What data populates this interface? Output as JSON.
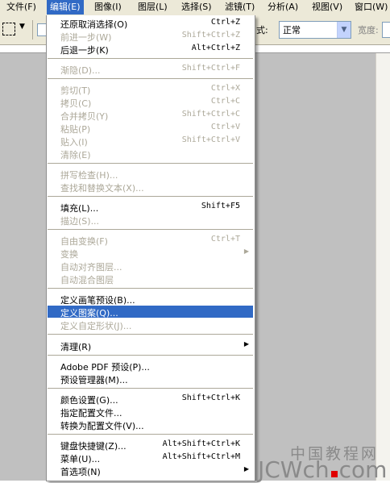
{
  "menubar": {
    "items": [
      {
        "label": "文件(F)"
      },
      {
        "label": "编辑(E)",
        "active": true
      },
      {
        "label": "图像(I)"
      },
      {
        "label": "图层(L)"
      },
      {
        "label": "选择(S)"
      },
      {
        "label": "滤镜(T)"
      },
      {
        "label": "分析(A)"
      },
      {
        "label": "视图(V)"
      },
      {
        "label": "窗口(W)"
      }
    ]
  },
  "options": {
    "mode_label": "式:",
    "mode_value": "正常",
    "width_label": "宽度:"
  },
  "edit_menu": {
    "items": [
      {
        "label": "还原取消选择(O)",
        "shortcut": "Ctrl+Z",
        "enabled": true
      },
      {
        "label": "前进一步(W)",
        "shortcut": "Shift+Ctrl+Z",
        "enabled": false
      },
      {
        "label": "后退一步(K)",
        "shortcut": "Alt+Ctrl+Z",
        "enabled": true
      },
      {
        "label": "渐隐(D)...",
        "shortcut": "Shift+Ctrl+F",
        "enabled": false
      },
      {
        "label": "剪切(T)",
        "shortcut": "Ctrl+X",
        "enabled": false
      },
      {
        "label": "拷贝(C)",
        "shortcut": "Ctrl+C",
        "enabled": false
      },
      {
        "label": "合并拷贝(Y)",
        "shortcut": "Shift+Ctrl+C",
        "enabled": false
      },
      {
        "label": "粘贴(P)",
        "shortcut": "Ctrl+V",
        "enabled": false
      },
      {
        "label": "贴入(I)",
        "shortcut": "Shift+Ctrl+V",
        "enabled": false
      },
      {
        "label": "清除(E)",
        "shortcut": "",
        "enabled": false
      },
      {
        "label": "拼写检查(H)...",
        "shortcut": "",
        "enabled": false
      },
      {
        "label": "查找和替换文本(X)...",
        "shortcut": "",
        "enabled": false
      },
      {
        "label": "填充(L)...",
        "shortcut": "Shift+F5",
        "enabled": true
      },
      {
        "label": "描边(S)...",
        "shortcut": "",
        "enabled": false
      },
      {
        "label": "自由变换(F)",
        "shortcut": "Ctrl+T",
        "enabled": false
      },
      {
        "label": "变换",
        "shortcut": "",
        "enabled": false,
        "submenu": true
      },
      {
        "label": "自动对齐图层...",
        "shortcut": "",
        "enabled": false
      },
      {
        "label": "自动混合图层",
        "shortcut": "",
        "enabled": false
      },
      {
        "label": "定义画笔预设(B)...",
        "shortcut": "",
        "enabled": true
      },
      {
        "label": "定义图案(Q)...",
        "shortcut": "",
        "enabled": true,
        "highlighted": true
      },
      {
        "label": "定义自定形状(J)...",
        "shortcut": "",
        "enabled": false
      },
      {
        "label": "清理(R)",
        "shortcut": "",
        "enabled": true,
        "submenu": true
      },
      {
        "label": "Adobe PDF 预设(P)...",
        "shortcut": "",
        "enabled": true
      },
      {
        "label": "预设管理器(M)...",
        "shortcut": "",
        "enabled": true
      },
      {
        "label": "颜色设置(G)...",
        "shortcut": "Shift+Ctrl+K",
        "enabled": true
      },
      {
        "label": "指定配置文件...",
        "shortcut": "",
        "enabled": true
      },
      {
        "label": "转换为配置文件(V)...",
        "shortcut": "",
        "enabled": true
      },
      {
        "label": "键盘快捷键(Z)...",
        "shortcut": "Alt+Shift+Ctrl+K",
        "enabled": true
      },
      {
        "label": "菜单(U)...",
        "shortcut": "Alt+Shift+Ctrl+M",
        "enabled": true
      },
      {
        "label": "首选项(N)",
        "shortcut": "",
        "enabled": true,
        "submenu": true
      }
    ]
  },
  "watermark": {
    "line1": "中国教程网",
    "line2_a": "JCWch",
    "line2_b": "com"
  },
  "colors": {
    "highlight": "#316ac5",
    "disabled": "#aca899",
    "menubar_bg": "#ece9d8",
    "canvas_bg": "#c0c0c0"
  }
}
